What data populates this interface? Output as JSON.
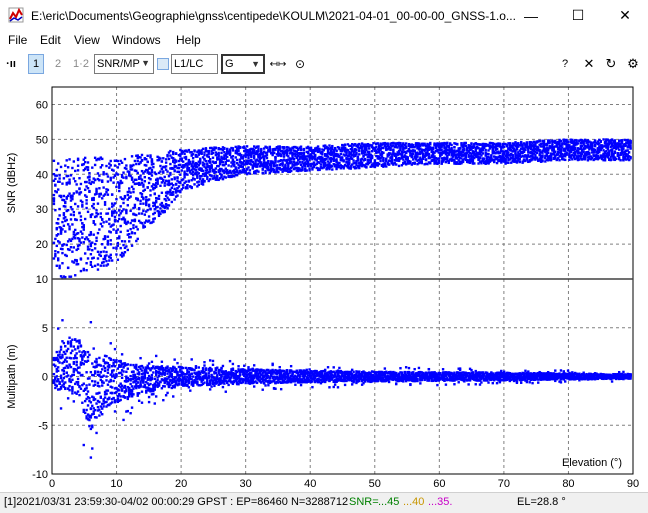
{
  "window": {
    "title": "E:\\eric\\Documents\\Geographie\\gnss\\centipede\\KOULM\\2021-04-01_00-00-00_GNSS-1.o...",
    "minimize_glyph": "—",
    "maximize_glyph": "☐",
    "close_glyph": "✕"
  },
  "menu": {
    "items": [
      "File",
      "Edit",
      "View",
      "Windows",
      "Help"
    ]
  },
  "toolbar": {
    "grip": "·ıı",
    "btn_1": "1",
    "btn_2": "2",
    "btn_12": "1·2",
    "plot_type": "SNR/MP",
    "freq": "L1/LC",
    "system": "G",
    "fit_icon_glyph": "↤↦",
    "center_icon_glyph": "⊙",
    "help_glyph": "?",
    "close_glyph": "✕",
    "refresh_glyph": "↻",
    "settings_glyph": "⚙"
  },
  "chart_data": [
    {
      "type": "scatter",
      "title": "",
      "xlabel": "",
      "ylabel": "SNR (dBHz)",
      "xlim": [
        0,
        90
      ],
      "ylim": [
        10,
        65
      ],
      "yticks": [
        10,
        20,
        30,
        40,
        50,
        60
      ],
      "grid": true,
      "color": "#0000ff",
      "series": [
        {
          "x": [
            0,
            2,
            4,
            6,
            8,
            10,
            12,
            14,
            16,
            18,
            20,
            25,
            30,
            40,
            50,
            60,
            70,
            80,
            90
          ],
          "y_min": [
            10,
            10,
            11,
            12,
            13,
            15,
            18,
            23,
            27,
            30,
            35,
            38,
            40,
            41,
            42,
            43,
            43,
            44,
            44
          ],
          "y_max": [
            44,
            44,
            45,
            45,
            45,
            45,
            45,
            46,
            46,
            47,
            47,
            48,
            48,
            48,
            49,
            49,
            49,
            50,
            50
          ]
        }
      ]
    },
    {
      "type": "scatter",
      "title": "",
      "xlabel": "Elevation (°)",
      "ylabel": "Multipath (m)",
      "xlim": [
        0,
        90
      ],
      "ylim": [
        -10,
        10
      ],
      "xticks": [
        0,
        10,
        20,
        30,
        40,
        50,
        60,
        70,
        80,
        90
      ],
      "yticks": [
        -10,
        -5,
        0,
        5
      ],
      "grid": true,
      "color": "#0000ff",
      "series": [
        {
          "x": [
            0,
            2,
            4,
            6,
            8,
            10,
            12,
            15,
            20,
            30,
            40,
            50,
            60,
            70,
            80,
            90
          ],
          "y_min": [
            -3,
            -4,
            -5,
            -9.5,
            -6,
            -5,
            -4,
            -3,
            -2,
            -1.5,
            -1.2,
            -1,
            -0.9,
            -0.8,
            -0.6,
            -0.5
          ],
          "y_max": [
            3,
            7,
            7,
            6,
            5,
            4,
            3,
            2.5,
            2,
            1.5,
            1.2,
            1,
            0.9,
            0.8,
            0.6,
            0.5
          ]
        }
      ]
    }
  ],
  "status": {
    "info": "[1]2021/03/31 23:59:30-04/02 00:00:29 GPST : EP=86460 N=3288712",
    "snr_label": "SNR=",
    "snr_1": "...45",
    "snr_2": "...40",
    "snr_3": "...35.",
    "el": "EL=28.8 °",
    "colors": {
      "green": "#008000",
      "orange": "#c89600",
      "magenta": "#c800c8"
    }
  }
}
